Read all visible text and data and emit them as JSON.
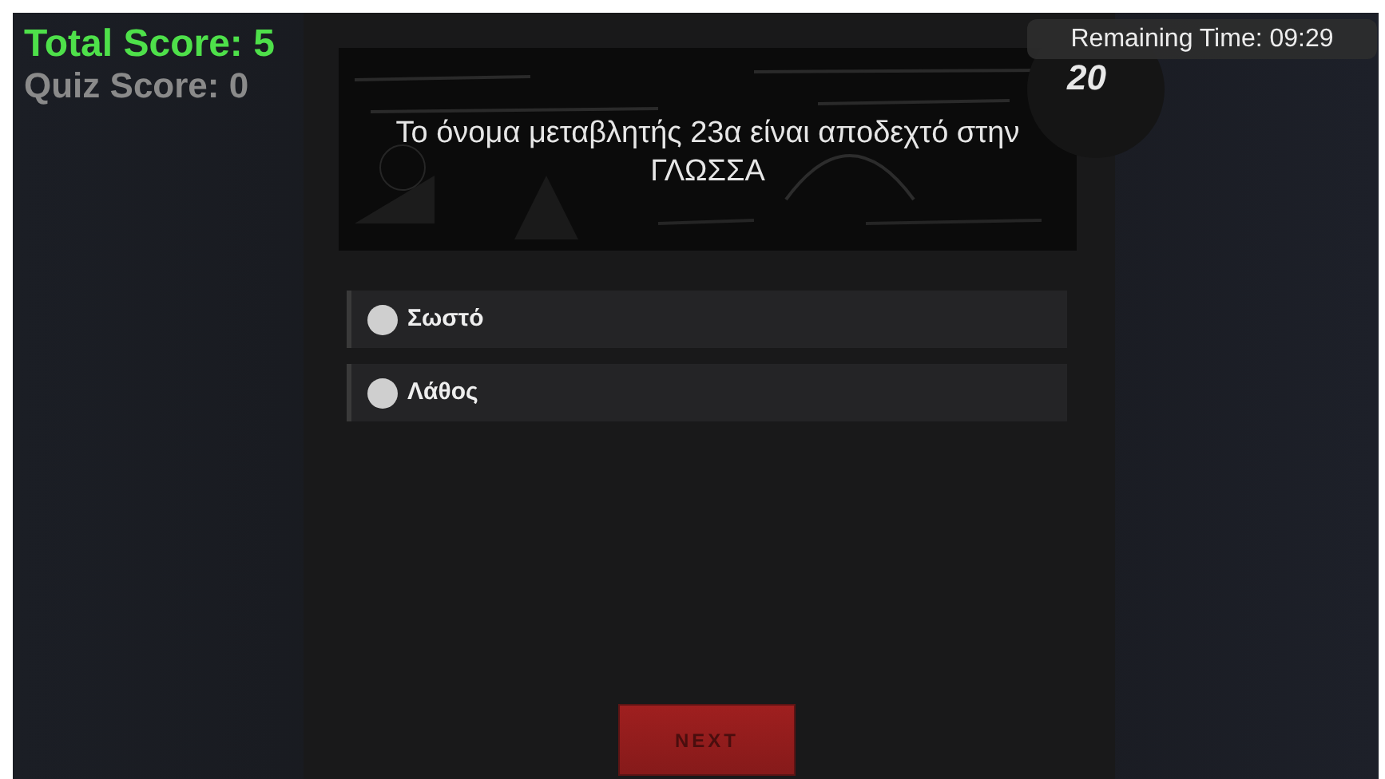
{
  "total_score": "Total Score: 5",
  "quiz_score": "Quiz Score: 0",
  "remaining_time": "Remaining Time: 09:29",
  "question_number": "20",
  "question": "Το όνομα μεταβλητής 23α είναι αποδεχτό στην ΓΛΩΣΣΑ",
  "options": [
    {
      "label": "Σωστό",
      "selected": false
    },
    {
      "label": "Λάθος",
      "selected": false
    }
  ],
  "next_button": {
    "label": "NEXT",
    "disabled": true
  }
}
